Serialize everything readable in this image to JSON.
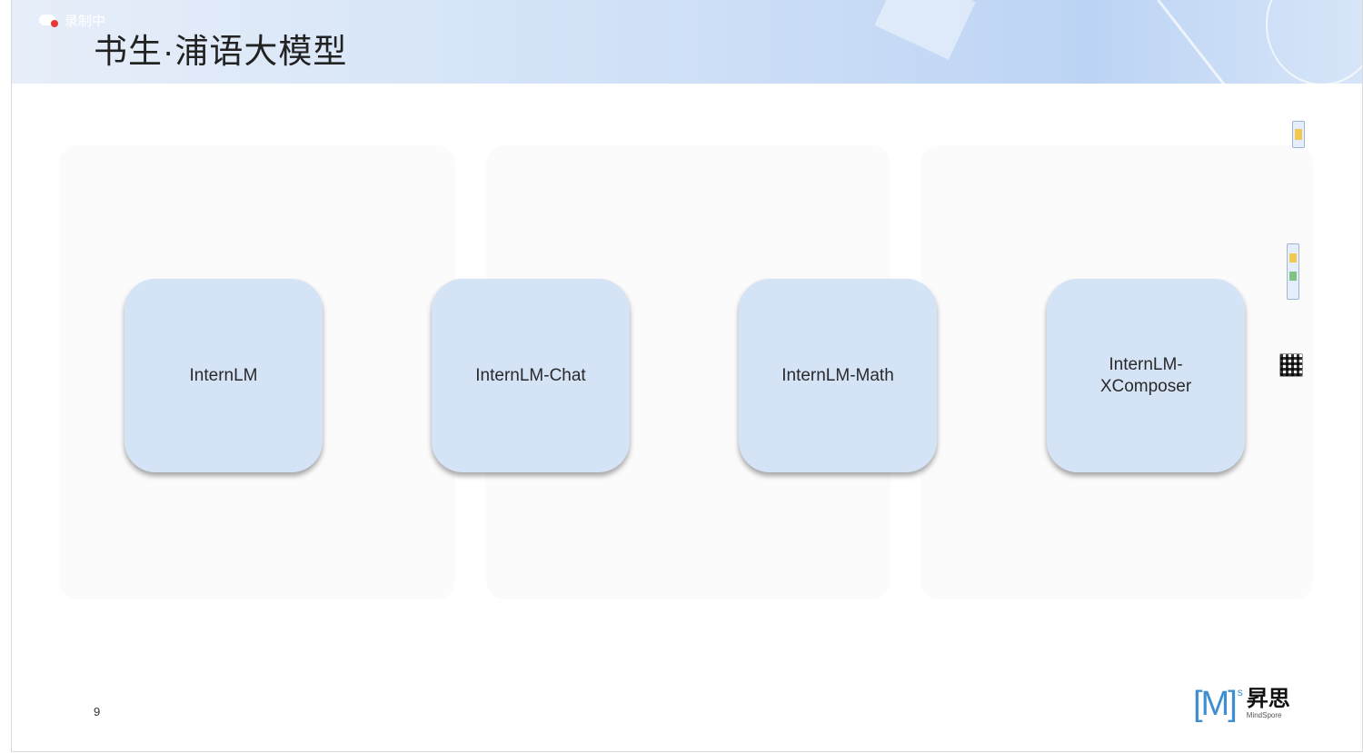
{
  "header": {
    "recording_label": "录制中",
    "title": "书生·浦语大模型"
  },
  "cards": [
    {
      "label": "InternLM"
    },
    {
      "label": "InternLM-Chat"
    },
    {
      "label": "InternLM-Math"
    },
    {
      "label": "InternLM-XComposer"
    }
  ],
  "footer": {
    "page_number": "9",
    "logo_mark": "[M]",
    "logo_sup": "s",
    "logo_cn": "昇思",
    "logo_en": "MindSpore"
  },
  "colors": {
    "card_fill": "#d5e3f6",
    "logo_blue": "#3d8fd1",
    "recording_dot": "#e53935"
  },
  "icons": [
    "cloud-record-icon",
    "phone-preview-icon",
    "phone-preview-long-icon",
    "qr-code-icon"
  ]
}
